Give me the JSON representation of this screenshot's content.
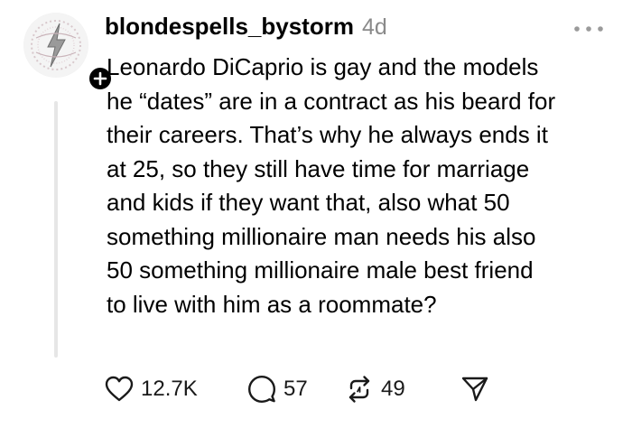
{
  "post": {
    "username": "blondespells_bystorm",
    "timestamp": "4d",
    "avatar_icon": "avatar-lightning-logo-icon",
    "follow_icon": "plus-icon",
    "more_icon": "more-horizontal-icon",
    "body_lines": [
      "Leonardo DiCaprio is gay and the models",
      "he “dates” are in a contract as his beard for",
      "their careers. That’s why he always ends it",
      "at 25, so they still have time for marriage",
      "and kids if they want that, also what 50",
      "something millionaire man needs his also",
      "50 something millionaire male best friend",
      "to live with him as a roommate?"
    ]
  },
  "actions": {
    "like": {
      "icon": "heart-icon",
      "count": "12.7K"
    },
    "comment": {
      "icon": "comment-bubble-icon",
      "count": "57"
    },
    "repost": {
      "icon": "repost-icon",
      "count": "49"
    },
    "share": {
      "icon": "send-icon"
    }
  },
  "colors": {
    "text": "#000000",
    "muted": "#8a8a8a",
    "thread_line": "#e6e6e6",
    "background": "#ffffff"
  }
}
